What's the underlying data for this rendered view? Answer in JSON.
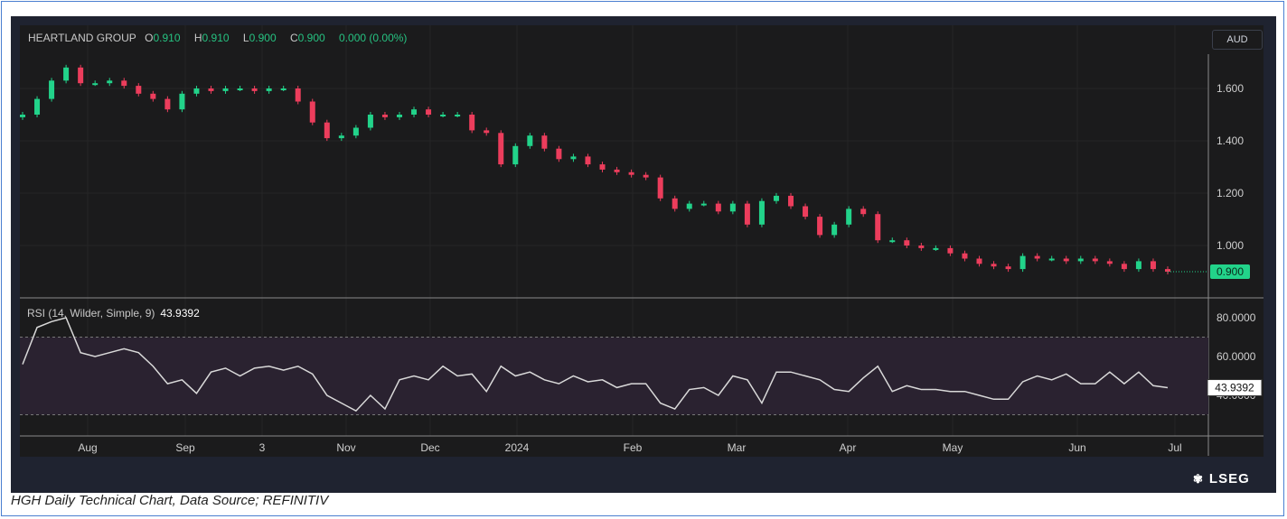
{
  "header": {
    "symbol": "HEARTLAND GROUP",
    "o_label": "O",
    "o": "0.910",
    "h_label": "H",
    "h": "0.910",
    "l_label": "L",
    "l": "0.900",
    "c_label": "C",
    "c": "0.900",
    "change": "0.000 (0.00%)",
    "currency": "AUD"
  },
  "rsi": {
    "label": "RSI (14, Wilder, Simple, 9)",
    "value": "43.9392"
  },
  "caption": "HGH Daily Technical Chart, Data Source; REFINITIV",
  "brand": "LSEG",
  "colors": {
    "up": "#22d38a",
    "down": "#ec3d5c",
    "rsi": "#d9d9d9"
  },
  "chart_data": [
    {
      "type": "candlestick",
      "title": "HEARTLAND GROUP",
      "ylim": [
        0.87,
        1.75
      ],
      "yticks": [
        "1.600",
        "1.400",
        "1.200",
        "1.000"
      ],
      "ytick_values": [
        1.6,
        1.4,
        1.2,
        1.0
      ],
      "last_price": "0.900",
      "xticks": [
        "Aug",
        "Sep",
        "3",
        "Nov",
        "Dec",
        "2024",
        "Feb",
        "Mar",
        "Apr",
        "May",
        "Jun",
        "Jul"
      ],
      "closes": [
        1.5,
        1.56,
        1.63,
        1.68,
        1.62,
        1.62,
        1.63,
        1.61,
        1.58,
        1.56,
        1.52,
        1.58,
        1.6,
        1.59,
        1.6,
        1.6,
        1.59,
        1.6,
        1.6,
        1.55,
        1.47,
        1.41,
        1.42,
        1.45,
        1.5,
        1.49,
        1.5,
        1.52,
        1.5,
        1.5,
        1.5,
        1.44,
        1.43,
        1.31,
        1.38,
        1.42,
        1.37,
        1.33,
        1.34,
        1.31,
        1.29,
        1.28,
        1.27,
        1.26,
        1.18,
        1.14,
        1.16,
        1.16,
        1.13,
        1.16,
        1.08,
        1.17,
        1.19,
        1.15,
        1.11,
        1.04,
        1.08,
        1.14,
        1.12,
        1.02,
        1.02,
        1.0,
        0.99,
        0.99,
        0.97,
        0.95,
        0.93,
        0.92,
        0.91,
        0.96,
        0.95,
        0.95,
        0.94,
        0.95,
        0.94,
        0.93,
        0.91,
        0.94,
        0.91,
        0.9
      ]
    },
    {
      "type": "line",
      "title": "RSI (14, Wilder, Simple, 9)",
      "ylim": [
        20,
        85
      ],
      "yticks": [
        "80.0000",
        "60.0000",
        "40.0000"
      ],
      "ytick_values": [
        80,
        60,
        40
      ],
      "bands": [
        30,
        70
      ],
      "values": [
        56,
        75,
        78,
        80,
        62,
        60,
        62,
        64,
        62,
        55,
        46,
        48,
        41,
        52,
        54,
        50,
        54,
        55,
        53,
        55,
        51,
        40,
        36,
        32,
        40,
        33,
        48,
        50,
        48,
        55,
        50,
        51,
        42,
        55,
        50,
        52,
        48,
        46,
        50,
        47,
        48,
        44,
        46,
        46,
        36,
        33,
        43,
        44,
        40,
        50,
        48,
        36,
        52,
        52,
        50,
        48,
        43,
        42,
        49,
        55,
        42,
        45,
        43,
        43,
        42,
        42,
        40,
        38,
        38,
        47,
        50,
        48,
        51,
        46,
        46,
        52,
        46,
        52,
        45,
        43.94
      ]
    }
  ]
}
